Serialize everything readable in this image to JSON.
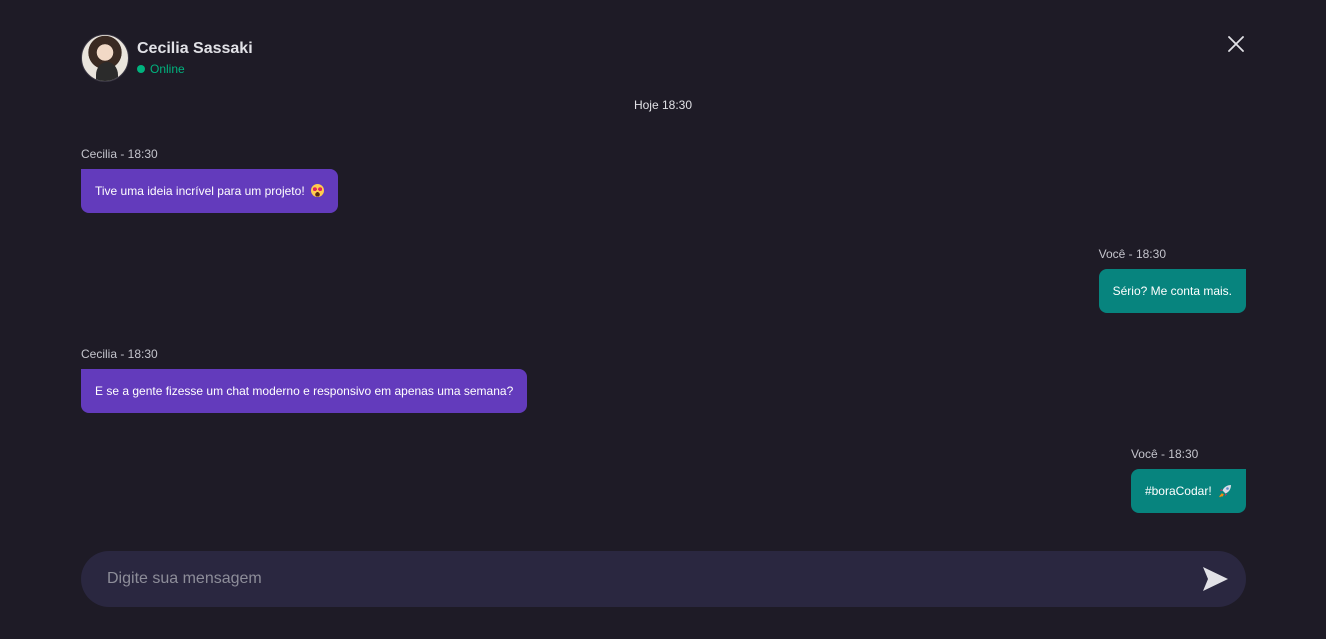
{
  "contact": {
    "name": "Cecilia Sassaki",
    "status": "Online"
  },
  "chat": {
    "date_divider": "Hoje 18:30",
    "messages": [
      {
        "from": "them",
        "meta": "Cecilia - 18:30",
        "text": "Tive uma ideia incrível para um projeto! ",
        "emoji": "heart-eyes-emoji"
      },
      {
        "from": "me",
        "meta": "Você - 18:30",
        "text": "Sério? Me conta mais."
      },
      {
        "from": "them",
        "meta": "Cecilia - 18:30",
        "text": "E se a gente fizesse um chat moderno e responsivo em apenas uma semana?"
      },
      {
        "from": "me",
        "meta": "Você - 18:30",
        "text": "#boraCodar! ",
        "emoji": "rocket-emoji"
      }
    ]
  },
  "composer": {
    "placeholder": "Digite sua mensagem"
  },
  "colors": {
    "background": "#1e1b26",
    "them_bubble": "#633bbc",
    "me_bubble": "#07847e",
    "online": "#00b37e",
    "input_bg": "#2a2740"
  },
  "icons": {
    "close": "close-icon",
    "send": "send-icon"
  }
}
